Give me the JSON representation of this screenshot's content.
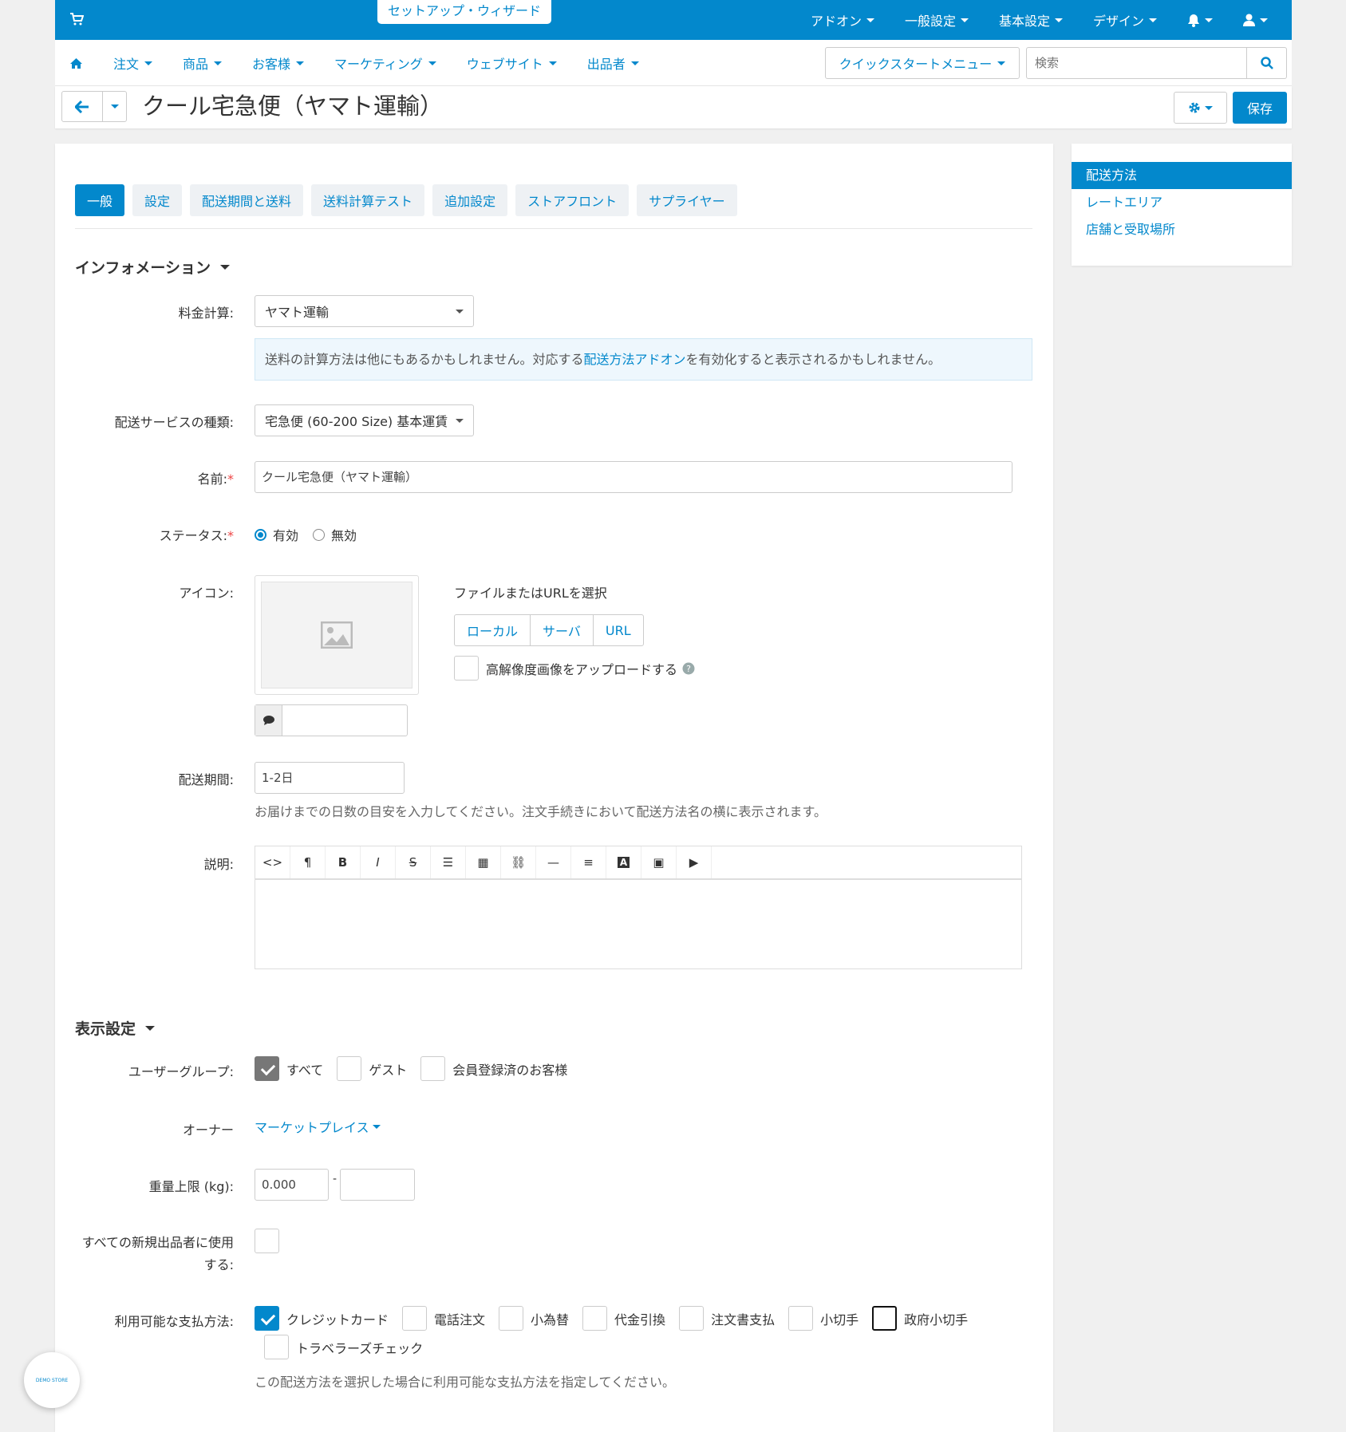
{
  "topbar": {
    "wizard_label": "セットアップ・ウィザード",
    "menu": [
      "アドオン",
      "一般設定",
      "基本設定",
      "デザイン"
    ]
  },
  "nav": {
    "items": [
      "注文",
      "商品",
      "お客様",
      "マーケティング",
      "ウェブサイト",
      "出品者"
    ],
    "quickstart_label": "クイックスタートメニュー",
    "search_placeholder": "検索"
  },
  "titlebar": {
    "title": "クール宅急便（ヤマト運輸）",
    "save_label": "保存"
  },
  "sidebar": {
    "items": [
      "配送方法",
      "レートエリア",
      "店舗と受取場所"
    ]
  },
  "tabs": [
    "一般",
    "設定",
    "配送期間と送料",
    "送料計算テスト",
    "追加設定",
    "ストアフロント",
    "サプライヤー"
  ],
  "info_section": {
    "title": "インフォメーション",
    "rate_calc_label": "料金計算:",
    "rate_calc_value": "ヤマト運輸",
    "info_pre": "送料の計算方法は他にもあるかもしれません。対応する",
    "info_link": "配送方法アドオン",
    "info_post": "を有効化すると表示されるかもしれません。",
    "service_label": "配送サービスの種類:",
    "service_value": "宅急便 (60-200 Size) 基本運賃",
    "name_label": "名前:",
    "name_value": "クール宅急便（ヤマト運輸）",
    "status_label": "ステータス:",
    "status_active": "有効",
    "status_inactive": "無効",
    "icon_label": "アイコン:",
    "file_or_url": "ファイルまたはURLを選択",
    "source_buttons": [
      "ローカル",
      "サーバ",
      "URL"
    ],
    "hires_label": "高解像度画像をアップロードする",
    "delivery_label": "配送期間:",
    "delivery_value": "1-2日",
    "delivery_help": "お届けまでの日数の目安を入力してください。注文手続きにおいて配送方法名の横に表示されます。",
    "desc_label": "説明:"
  },
  "display_section": {
    "title": "表示設定",
    "usergroup_label": "ユーザーグループ:",
    "usergroups": [
      "すべて",
      "ゲスト",
      "会員登録済のお客様"
    ],
    "owner_label": "オーナー",
    "owner_value": "マーケットプレイス",
    "weight_label": "重量上限 (kg):",
    "weight_min": "0.000",
    "weight_sep": "-",
    "new_vendor_label_1": "すべての新規出品者に使用",
    "new_vendor_label_2": "する:",
    "payment_label": "利用可能な支払方法:",
    "payments": [
      "クレジットカード",
      "電話注文",
      "小為替",
      "代金引換",
      "注文書支払",
      "小切手",
      "政府小切手",
      "トラベラーズチェック"
    ],
    "payment_help": "この配送方法を選択した場合に利用可能な支払方法を指定してください。"
  },
  "demo_badge": "DEMO STORE",
  "colors": {
    "accent": "#0388cc",
    "background": "#f0f0f0"
  }
}
